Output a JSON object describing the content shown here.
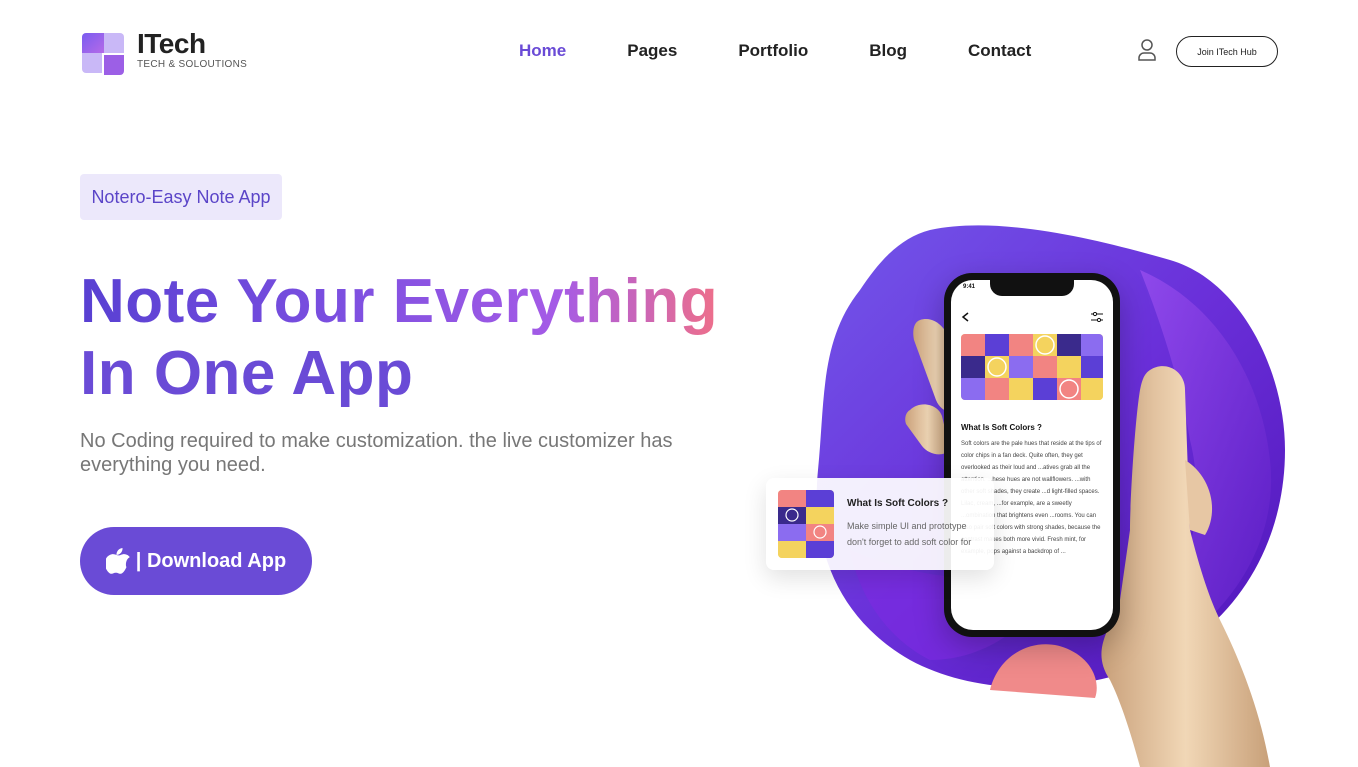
{
  "brand": {
    "title": "ITech",
    "subtitle": "TECH & SOLOUTIONS",
    "colors": {
      "primary": "#6a4bd6",
      "tag_bg": "#ece8fb",
      "accent_pink": "#ee6f8a"
    }
  },
  "nav": {
    "items": [
      {
        "label": "Home",
        "active": true
      },
      {
        "label": "Pages",
        "active": false
      },
      {
        "label": "Portfolio",
        "active": false
      },
      {
        "label": "Blog",
        "active": false
      },
      {
        "label": "Contact",
        "active": false
      }
    ],
    "user_icon": "user-icon",
    "join_label": "Join ITech Hub"
  },
  "hero": {
    "tag": "Notero-Easy Note App",
    "headline_part1": "Note Your ",
    "headline_part2": "Everything",
    "headline_line2": "In One App",
    "description": "No Coding required to make customization. the live customizer has everything you need.",
    "download_icon": "apple-icon",
    "download_label": "| Download App"
  },
  "phone": {
    "time": "9:41",
    "article_title": "What Is Soft Colors ?",
    "article_body": "Soft colors are the pale hues that reside at the tips of color chips in a fan deck. Quite often, they get overlooked as their loud and ...atives grab all the attention. ...hese hues are not wallflowers. ...with other soft shades, they create ...d light-filled spaces. Lilac, cream, ...for example, are a sweetly ...ombination that brightens even ...rooms. You can also pair soft colors with strong shades, because the contrast makes both more vivid. Fresh mint, for example, pops against a backdrop of ..."
  },
  "card": {
    "title": "What Is Soft Colors ?",
    "text": "Make simple UI and prototype don't forget to add soft color for"
  }
}
